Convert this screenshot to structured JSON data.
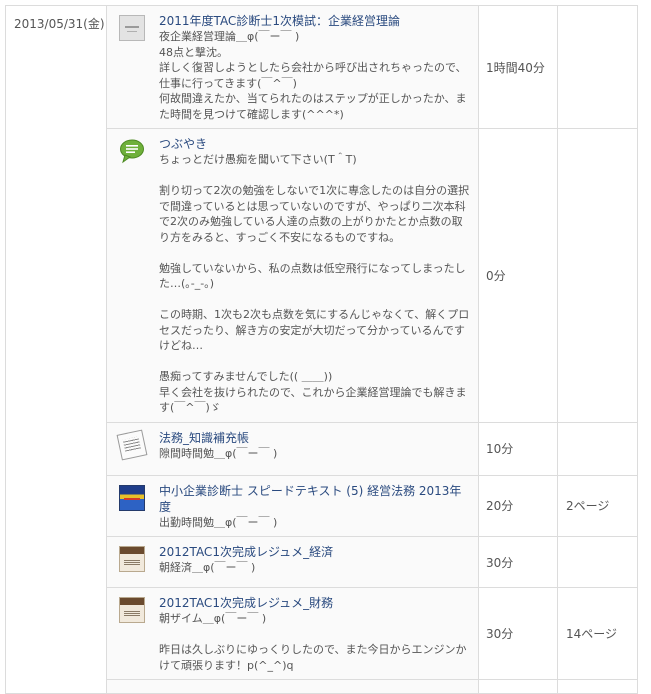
{
  "date": "2013/05/31(金)",
  "rows": [
    {
      "title": "2011年度TAC診断士1次模試：企業経営理論",
      "lines": [
        "夜企業経営理論＿φ(￣ー￣ )",
        "48点と撃沈。",
        "詳しく復習しようとしたら会社から呼び出されちゃったので、",
        "仕事に行ってきます(￣^￣)",
        "何故間違えたか、当てられたのはステップが正しかったか、ま",
        "た時間を見つけて確認します(^^^*)"
      ],
      "time": "1時間40分",
      "pages": ""
    },
    {
      "title": "つぶやき",
      "lines": [
        "ちょっとだけ愚痴を聞いて下さい(T＾T)",
        "",
        "割り切って2次の勉強をしないで1次に専念したのは自分の選択",
        "で間違っているとは思っていないのですが、やっぱり二次本科",
        "で2次のみ勉強している人達の点数の上がりかたとか点数の取",
        "り方をみると、すっごく不安になるものですね。",
        "",
        "勉強していないから、私の点数は低空飛行になってしまったし",
        "た…(｡-_-｡)",
        "",
        "この時期、1次も2次も点数を気にするんじゃなくて、解くプロ",
        "セスだったり、解き方の安定が大切だって分かっているんです",
        "けどね…",
        "",
        "愚痴ってすみませんでした(( ＿＿))",
        "早く会社を抜けられたので、これから企業経営理論でも解きま",
        "す(￣^￣)ゞ"
      ],
      "time": "0分",
      "pages": ""
    },
    {
      "title": "法務_知識補充帳",
      "lines": [
        "隙間時間勉＿φ(￣ー￣ )"
      ],
      "time": "10分",
      "pages": ""
    },
    {
      "title": "中小企業診断士 スピードテキスト (5) 経営法務 2013年度",
      "lines": [
        "出勤時間勉＿φ(￣ー￣ )"
      ],
      "time": "20分",
      "pages": "2ページ"
    },
    {
      "title": "2012TAC1次完成レジュメ_経済",
      "lines": [
        "朝経済＿φ(￣ー￣ )"
      ],
      "time": "30分",
      "pages": ""
    },
    {
      "title": "2012TAC1次完成レジュメ_財務",
      "lines": [
        "朝ザイム＿φ(￣ー￣ )",
        "",
        "昨日は久しぶりにゆっくりしたので、また今日からエンジンか",
        "けて頑張ります！p(^_^)q"
      ],
      "time": "30分",
      "pages": "14ページ"
    }
  ],
  "icons": [
    "book-cover-thumbnail-icon",
    "speech-bubble-icon",
    "notebook-thumbnail-icon",
    "speed-text-book-thumbnail-icon",
    "resume-book-thumbnail-icon",
    "resume-book-thumbnail-icon"
  ],
  "colors": {
    "title_link": "#2a4a7f",
    "text": "#555555",
    "border": "#dcdcdc",
    "tweet_icon": "#6fb03a"
  }
}
